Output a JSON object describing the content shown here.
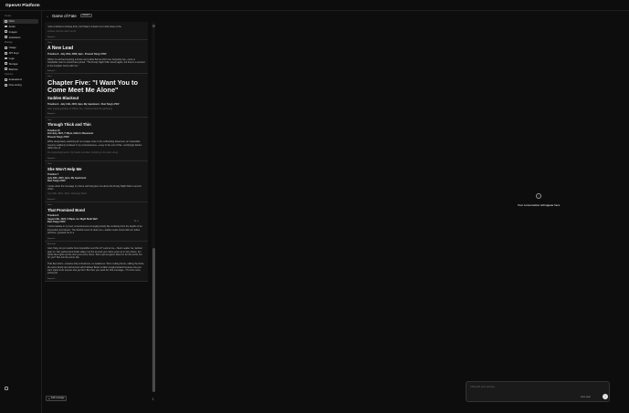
{
  "app": {
    "brand": "OpenAI Platform"
  },
  "sidebar": {
    "sections": [
      {
        "label": "Create",
        "items": [
          {
            "label": "Chat",
            "active": true,
            "icon": "chat-icon"
          },
          {
            "label": "Audio",
            "active": false,
            "icon": "audio-icon"
          },
          {
            "label": "Images",
            "active": false,
            "icon": "images-icon"
          },
          {
            "label": "Assistants",
            "active": false,
            "icon": "assistants-icon"
          }
        ]
      },
      {
        "label": "Manage",
        "items": [
          {
            "label": "Usage",
            "active": false,
            "icon": "usage-icon"
          },
          {
            "label": "API keys",
            "active": false,
            "icon": "key-icon"
          },
          {
            "label": "Logs",
            "active": false,
            "icon": "logs-icon"
          },
          {
            "label": "Storage",
            "active": false,
            "icon": "storage-icon"
          },
          {
            "label": "Batches",
            "active": false,
            "icon": "batches-icon"
          }
        ]
      },
      {
        "label": "Optimize",
        "items": [
          {
            "label": "Evaluations",
            "active": false,
            "icon": "evaluations-icon"
          },
          {
            "label": "Fine-tuning",
            "active": false,
            "icon": "fine-tuning-icon"
          }
        ]
      }
    ]
  },
  "header": {
    "back": "←",
    "title": "Game of Fate",
    "badge": "DRAFT"
  },
  "messages": [
    {
      "role": "",
      "heading": "",
      "meta": "",
      "body": "\"Lots of drinks to choose from, but Hailey's mission is to stick close to the",
      "faded": "surface until the storm ends\"",
      "expand": "Expand ⌄"
    },
    {
      "role": "User",
      "heading": "A New Lead",
      "headingSize": "md",
      "meta": "Timeline 8 - July 20th, 2008, 9pm - Present Tang's POV",
      "body": "Officer Gu arrived wearing a brown and yellow flannel shirt over burgundy tee—more a hospitable man he would have joined. \"The Dusky Night Killer struck again, but there's a survivor in the hospital. Come with me.\"",
      "faded": "",
      "expand": "Expand ⌄"
    },
    {
      "role": "User",
      "heading": "Chapter Five: \"I Want You to Come Meet Me Alone\"",
      "headingSize": "lg",
      "subheading": "Sudden Blackout",
      "meta": "Timeline 9 - July 11th, 2015, 9pm, My Apartment - Past Tang's POV",
      "body": "",
      "faded": "After saying goodbye to Officer Gu, I climbed back the gathering",
      "expand": "Expand ⌄"
    },
    {
      "role": "User",
      "heading": "Through Thick and Thin",
      "headingSize": "sm",
      "meta": "Timeline 10\n2nd July, 2024, 7:45pm, Hilton's Basement\nPresent Tang's POV",
      "body": "While desperately searching for an escape route in the suffocating basement, an impossible memory suddenly surfaced in my consciousness—a key to the exit of this—terrifyingly hidden within one of",
      "faded": "the supporting beams. My hands trembled, fumbling in the dark, dusty",
      "expand": "Expand ⌄"
    },
    {
      "role": "User",
      "heading": "She Won't Help Me",
      "headingSize": "sm",
      "meta": "Timeline 7\nJuly 20th, 2015, 9pm, My Apartment\nPast Tang's POV",
      "body": "I wrote down the message my future self had given me about the Dusky Night Killer's second victim.",
      "faded": "July 20th, 2015, 10pm, Jiaoyang Road",
      "expand": "Expand ⌄"
    },
    {
      "role": "User",
      "heading": "That Promised Bond",
      "headingSize": "sm",
      "meta": "Timeline 8\nAugust 9th, 2024, 5:30pm, Go Night Bank WeV\nPast Tang's POV",
      "body": "I stirred awake in my bed, consciousness emerging slowly like surfacing from the depths of an impossibly vivid dream. The familiar scent of clean sun—leather seats mixed with our police perfume—greeted me in a",
      "faded": "",
      "expand": "Expand ⌄"
    },
    {
      "role": "Assistant",
      "heading": "",
      "headingSize": "",
      "meta": "",
      "body": "God, Tang, do you realize how impossible next this is? Look at me—Team Leader Gu, tactical gear on, hair washed and bottle salary, but the second your name pops up on her phone, her whole face lights up like she's just come home. She's got ten game faces on for the world, but for you? She lets the armor slip.\n\nThat fleet short—massive ship at business, no weakness. She's cutting the tie, calling the shots, the same family are half ancient which Ehsan Botan is fallen single-handed because she just can't stand to let anyone else get hurt. But then you send her that message—\"I'll come soon, sorting for",
      "faded": "",
      "expand": "Expand ⌄"
    }
  ],
  "convo_footer": {
    "add_message": "Add message"
  },
  "empty_state": {
    "text": "Your conversation will appear here"
  },
  "chat_input": {
    "placeholder": "Chat with your prompt...",
    "auto_clear": "Auto-clear",
    "send": "↑"
  }
}
